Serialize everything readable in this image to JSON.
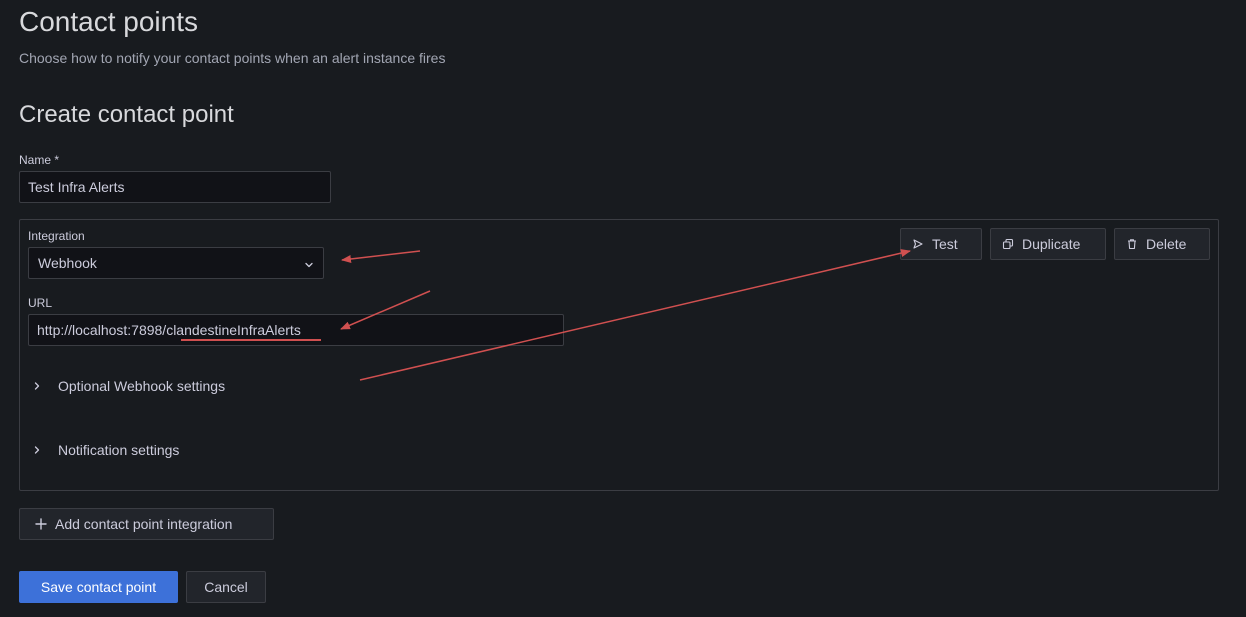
{
  "header": {
    "title": "Contact points",
    "subtitle": "Choose how to notify your contact points when an alert instance fires"
  },
  "form": {
    "section_title": "Create contact point",
    "name_label": "Name *",
    "name_value": "Test Infra Alerts"
  },
  "integration": {
    "label": "Integration",
    "selected": "Webhook",
    "url_label": "URL",
    "url_value": "http://localhost:7898/clandestineInfraAlerts",
    "test_button": "Test",
    "duplicate_button": "Duplicate",
    "delete_button": "Delete",
    "optional_settings": "Optional Webhook settings",
    "notification_settings": "Notification settings"
  },
  "actions": {
    "add_integration": "Add contact point integration",
    "save": "Save contact point",
    "cancel": "Cancel"
  },
  "colors": {
    "background": "#181b1f",
    "primary": "#3d71d9",
    "annotation": "#d05050"
  },
  "icons": [
    "send-icon",
    "copy-icon",
    "trash-icon",
    "chevron-down-icon",
    "chevron-right-icon",
    "plus-icon"
  ]
}
